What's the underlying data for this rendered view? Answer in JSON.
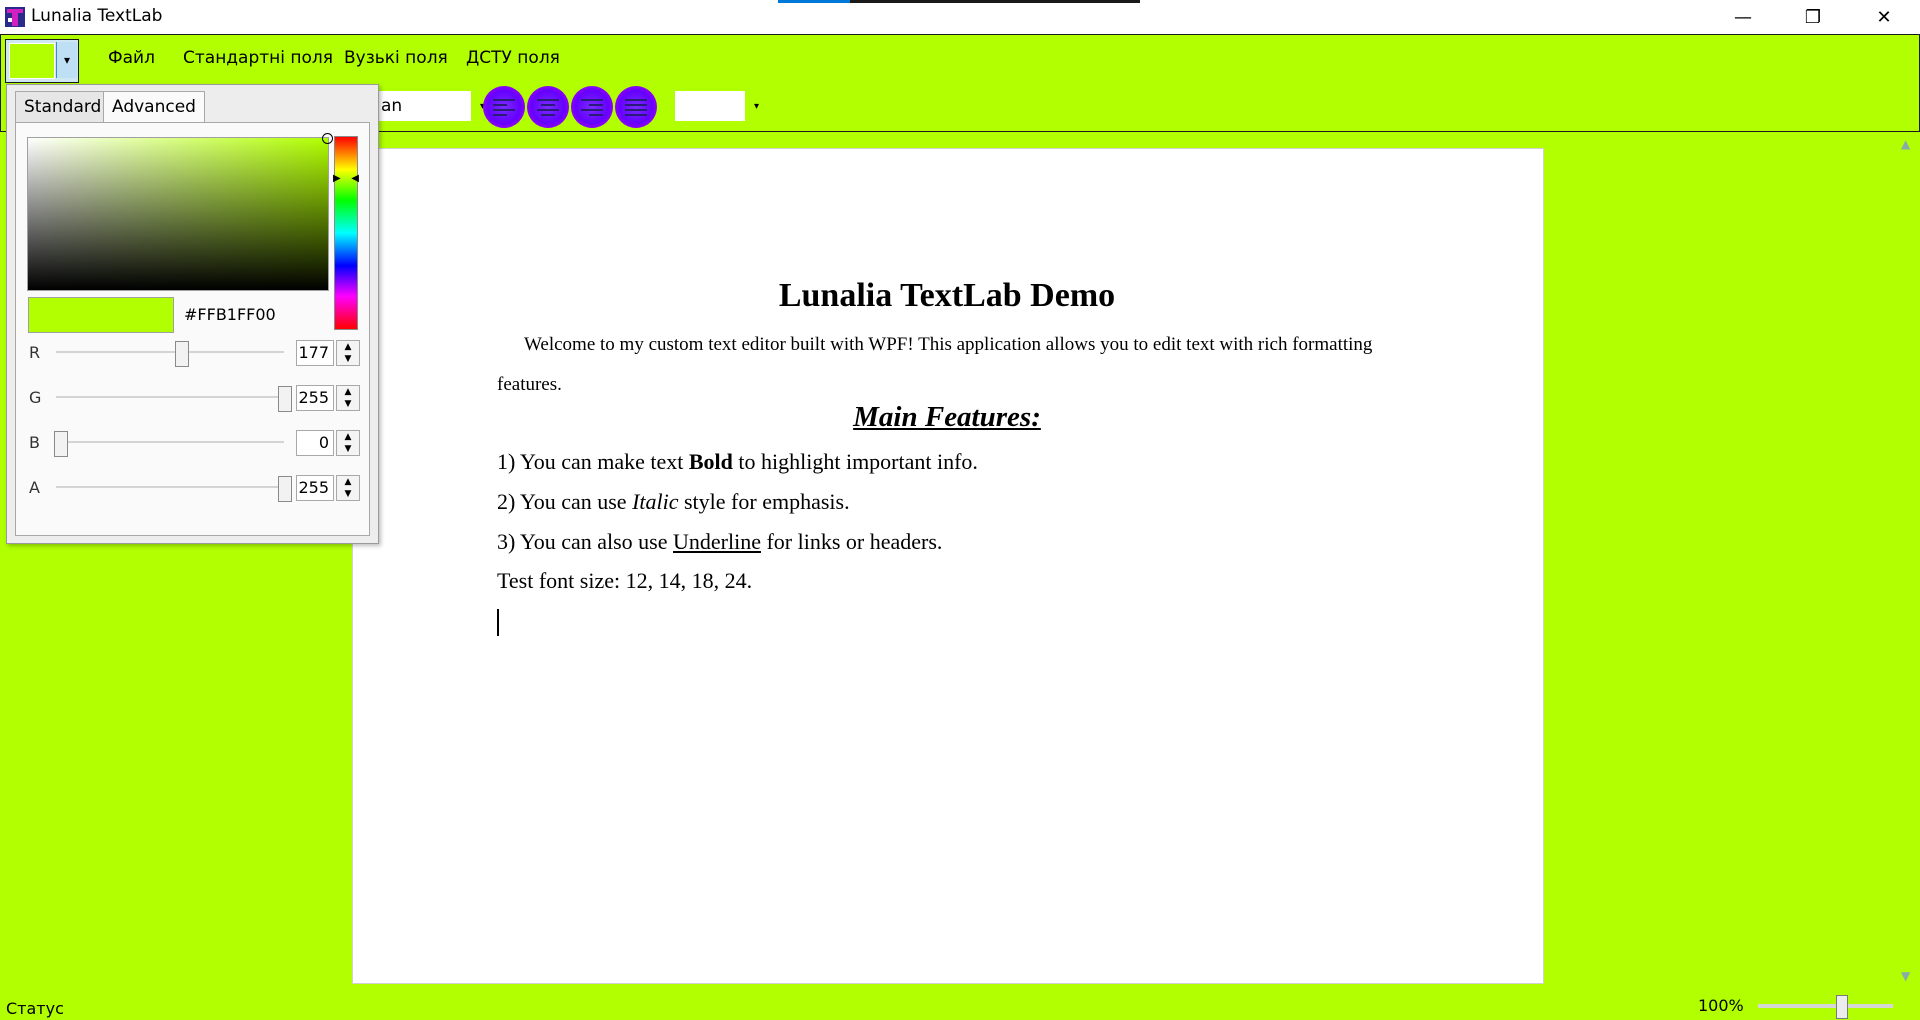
{
  "window": {
    "title": "Lunalia TextLab",
    "minimize_glyph": "—",
    "maximize_glyph": "❐",
    "close_glyph": "✕"
  },
  "menu": {
    "file": "Файл",
    "standard_margins": "Стандартні поля",
    "narrow_margins": "Вузькі поля",
    "dstu_margins": "ДСТУ поля"
  },
  "toolbar": {
    "font_name_visible": "an",
    "font_size_visible": "",
    "color_dropdown_glyph": "▾",
    "dropdown_glyph": "▾",
    "align_buttons": [
      "align-left",
      "align-center",
      "align-right",
      "align-justify"
    ]
  },
  "document": {
    "heading": "Lunalia TextLab Demo",
    "intro": "Welcome to my custom text editor built with WPF! This application allows you to edit text with rich formatting features.",
    "subheading": "Main Features:",
    "item1_prefix": "1) You can make text ",
    "item1_bold": "Bold",
    "item1_suffix": " to highlight important info.",
    "item2_prefix": "2) You can use ",
    "item2_italic": "Italic",
    "item2_suffix": " style for emphasis.",
    "item3_prefix": "3) You can also use ",
    "item3_underline": "Underline",
    "item3_suffix": " for links or headers.",
    "item4": "Test font size: 12, 14, 18, 24."
  },
  "color_picker": {
    "tabs": {
      "standard": "Standard",
      "advanced": "Advanced"
    },
    "active_tab": "Advanced",
    "hex": "#FFB1FF00",
    "channels": {
      "r": {
        "label": "R",
        "value": "177"
      },
      "g": {
        "label": "G",
        "value": "255"
      },
      "b": {
        "label": "B",
        "value": "0"
      },
      "a": {
        "label": "A",
        "value": "255"
      }
    },
    "selected_color": "#B1FF00"
  },
  "status": {
    "text": "Статус",
    "zoom": "100%"
  },
  "colors": {
    "background": "#B1FF00",
    "page": "#FFFFFF",
    "align_button": "#6600FF"
  }
}
